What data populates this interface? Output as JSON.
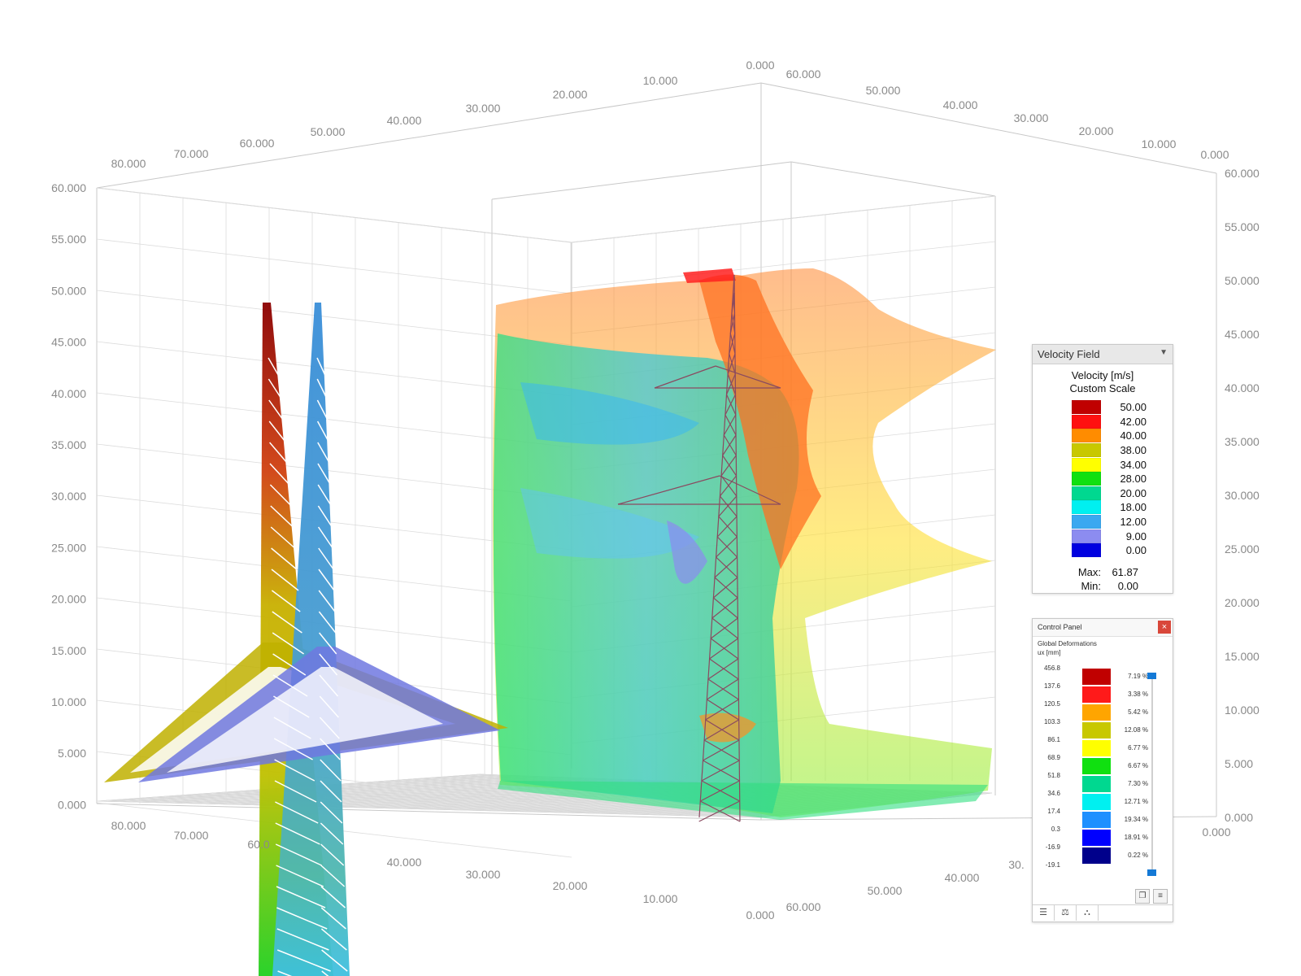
{
  "axes": {
    "vertical_left": [
      "60.000",
      "55.000",
      "50.000",
      "45.000",
      "40.000",
      "35.000",
      "30.000",
      "25.000",
      "20.000",
      "15.000",
      "10.000",
      "5.000",
      "0.000"
    ],
    "vertical_right": [
      "60.000",
      "55.000",
      "50.000",
      "45.000",
      "40.000",
      "35.000",
      "30.000",
      "25.000",
      "20.000",
      "15.000",
      "10.000",
      "5.000",
      "0.000"
    ],
    "top_left_edge": [
      "80.000",
      "70.000",
      "60.000",
      "50.000",
      "40.000",
      "30.000",
      "20.000",
      "10.000",
      "0.000"
    ],
    "top_right_edge": [
      "60.000",
      "50.000",
      "40.000",
      "30.000",
      "20.000",
      "10.000",
      "0.000"
    ],
    "bottom_left_edge": [
      "80.000",
      "70.000",
      "60.0",
      "40.000",
      "30.000",
      "20.000",
      "10.000",
      "0.000"
    ],
    "bottom_right_edge": [
      "60.000",
      "50.000",
      "40.000",
      "30.",
      "0.000"
    ]
  },
  "velocity_panel": {
    "title": "Velocity Field",
    "quantity": "Velocity [m/s]",
    "scale": "Custom Scale",
    "legend": [
      {
        "value": "50.00",
        "color": "#c00000"
      },
      {
        "value": "42.00",
        "color": "#ff1010"
      },
      {
        "value": "40.00",
        "color": "#ff8c00"
      },
      {
        "value": "38.00",
        "color": "#c8c800"
      },
      {
        "value": "34.00",
        "color": "#ffff00"
      },
      {
        "value": "28.00",
        "color": "#10e010"
      },
      {
        "value": "20.00",
        "color": "#00d890"
      },
      {
        "value": "18.00",
        "color": "#00f0f0"
      },
      {
        "value": "12.00",
        "color": "#3aa8f0"
      },
      {
        "value": "9.00",
        "color": "#8c8cf0"
      },
      {
        "value": "0.00",
        "color": "#0000e0"
      }
    ],
    "max_label": "Max:",
    "max_value": "61.87",
    "min_label": "Min:",
    "min_value": "0.00"
  },
  "control_panel": {
    "title": "Control Panel",
    "close": "×",
    "subtitle": "Global Deformations",
    "unit": "ux [mm]",
    "values": [
      "456.8",
      "137.6",
      "120.5",
      "103.3",
      "86.1",
      "68.9",
      "51.8",
      "34.6",
      "17.4",
      "0.3",
      "-16.9",
      "-19.1"
    ],
    "bands": [
      {
        "color": "#c00000",
        "percent": "7.19 %"
      },
      {
        "color": "#ff1a1a",
        "percent": "3.38 %"
      },
      {
        "color": "#ffa500",
        "percent": "5.42 %"
      },
      {
        "color": "#c8c800",
        "percent": "12.08 %"
      },
      {
        "color": "#ffff00",
        "percent": "6.77 %"
      },
      {
        "color": "#10e010",
        "percent": "6.67 %"
      },
      {
        "color": "#00d890",
        "percent": "7.30 %"
      },
      {
        "color": "#00f0f0",
        "percent": "12.71 %"
      },
      {
        "color": "#1e90ff",
        "percent": "19.34 %"
      },
      {
        "color": "#0000ff",
        "percent": "18.91 %"
      },
      {
        "color": "#00008b",
        "percent": "0.22 %"
      }
    ],
    "toolbar_icons": [
      "copy-icon",
      "legend-settings-icon"
    ],
    "tabs": [
      "color-scale-tab",
      "balance-tab",
      "filter-tab"
    ]
  }
}
